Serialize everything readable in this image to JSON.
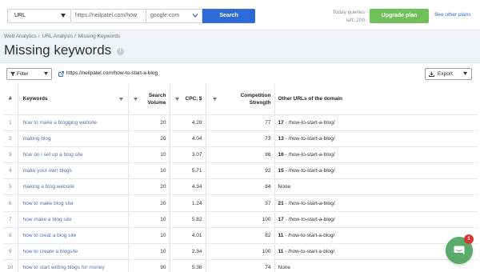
{
  "search": {
    "mode": "URL",
    "url_value": "https://neilpatel.com/how",
    "engine": "google.com",
    "button": "Search"
  },
  "quota": {
    "line1": "Today queries",
    "line2": "left: 200"
  },
  "upgrade_label": "Upgrade plan",
  "other_plans_label": "See other plans",
  "breadcrumb": [
    "Web Analytics",
    "URL Analysis",
    "Missing Keywords"
  ],
  "page_title": "Missing keywords",
  "toolbar": {
    "filter_label": "Filter",
    "domain": "https://neilpatel.com/how-to-start-a-blog",
    "export_label": "Export"
  },
  "table": {
    "headers": {
      "num": "#",
      "keywords": "Keywords",
      "volume": "Search Volume",
      "cpc": "CPC, $",
      "competition": "Competition Strength",
      "other": "Other URLs of the domain"
    },
    "rows": [
      {
        "num": "1",
        "keyword": "how to make a blogging website",
        "volume": "20",
        "cpc": "4.29",
        "competition": "77",
        "other_count": "17",
        "other_url": " - /how-to-start-a-blog/"
      },
      {
        "num": "2",
        "keyword": "making blog",
        "volume": "20",
        "cpc": "4.04",
        "competition": "73",
        "other_count": "13",
        "other_url": " - /how-to-start-a-blog/"
      },
      {
        "num": "3",
        "keyword": "how do i set up a blog site",
        "volume": "10",
        "cpc": "3.07",
        "competition": "86",
        "other_count": "16",
        "other_url": " - /how-to-start-a-blog/"
      },
      {
        "num": "4",
        "keyword": "make your own blogs",
        "volume": "10",
        "cpc": "5.71",
        "competition": "92",
        "other_count": "15",
        "other_url": " - /how-to-start-a-blog/"
      },
      {
        "num": "5",
        "keyword": "making a blog website",
        "volume": "20",
        "cpc": "4.34",
        "competition": "84",
        "other_count": "None",
        "other_url": ""
      },
      {
        "num": "6",
        "keyword": "how to make blog site",
        "volume": "20",
        "cpc": "1.24",
        "competition": "37",
        "other_count": "21",
        "other_url": " - /how-to-start-a-blog/"
      },
      {
        "num": "7",
        "keyword": "how make a blog site",
        "volume": "10",
        "cpc": "5.82",
        "competition": "100",
        "other_count": "17",
        "other_url": " - /how-to-start-a-blog/"
      },
      {
        "num": "8",
        "keyword": "how to creat a blog site",
        "volume": "10",
        "cpc": "4.01",
        "competition": "82",
        "other_count": "11",
        "other_url": " - /how-to-start-a-blog/"
      },
      {
        "num": "9",
        "keyword": "how to create a blogsite",
        "volume": "10",
        "cpc": "2.34",
        "competition": "100",
        "other_count": "11",
        "other_url": " - /how-to-start-a-blog/"
      },
      {
        "num": "10",
        "keyword": "how to start writing blogs for money",
        "volume": "90",
        "cpc": "5.36",
        "competition": "74",
        "other_count": "None",
        "other_url": ""
      }
    ]
  },
  "chat_badge": "1",
  "colors": {
    "primary": "#2d6ad6",
    "upgrade": "#70c15a",
    "chat": "#5aaa68",
    "badge": "#d93636",
    "keyword_link": "#5b72b0"
  }
}
